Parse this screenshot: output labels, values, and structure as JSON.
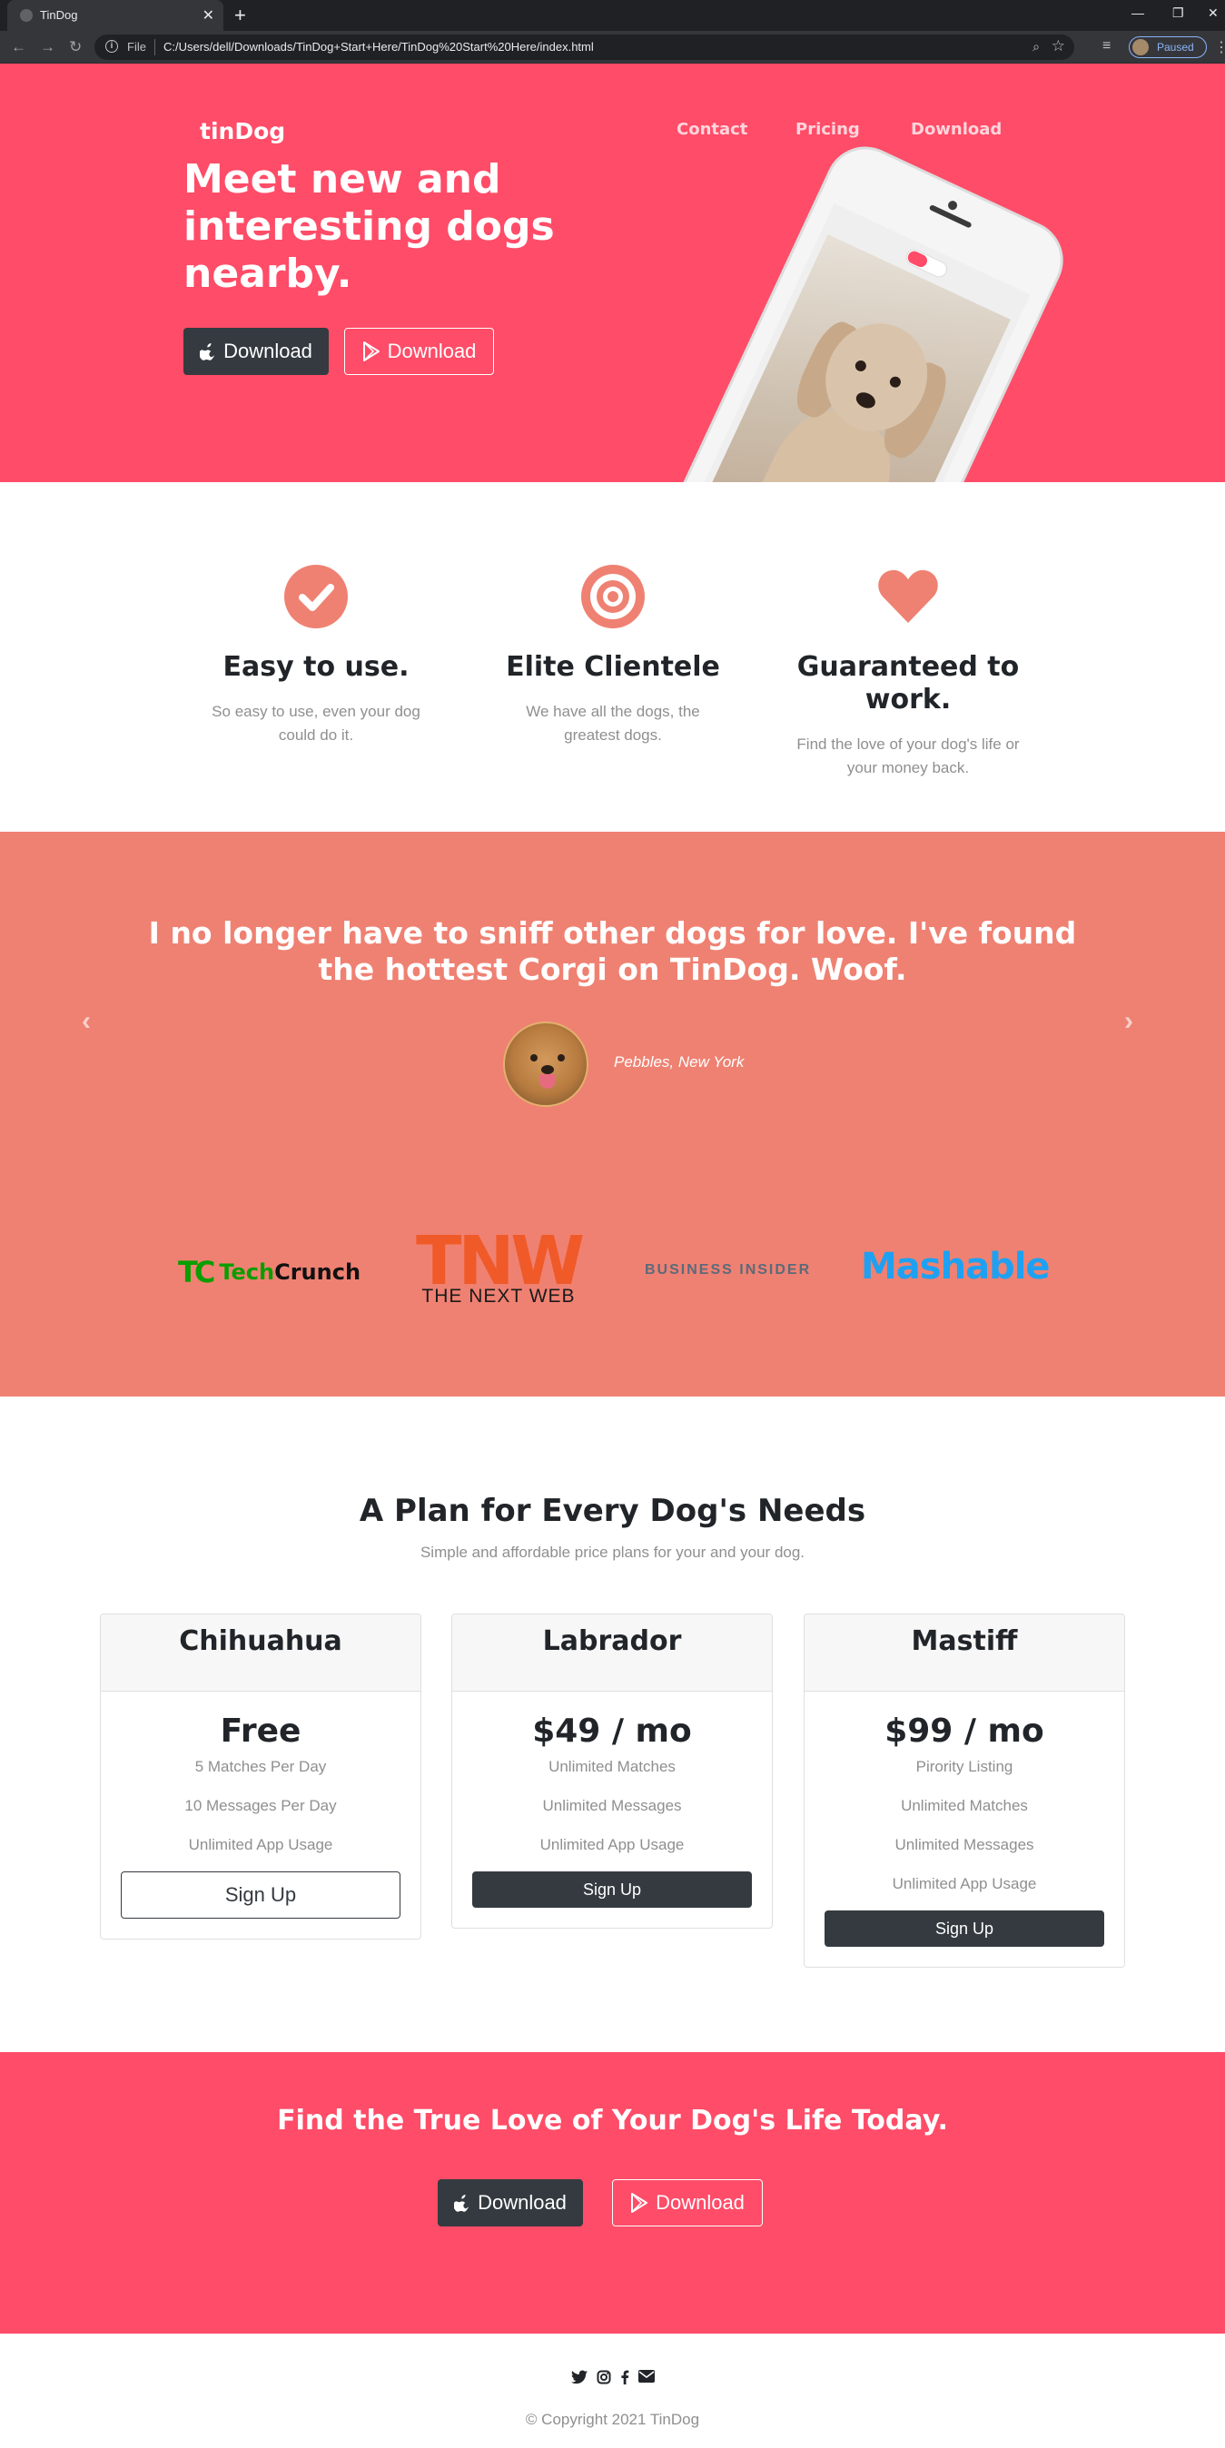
{
  "browser": {
    "tab_title": "TinDog",
    "address_scheme": "File",
    "url": "C:/Users/dell/Downloads/TinDog+Start+Here/TinDog%20Start%20Here/index.html",
    "profile_status": "Paused"
  },
  "hero": {
    "brand": "tinDog",
    "nav": [
      "Contact",
      "Pricing",
      "Download"
    ],
    "title": "Meet new and interesting dogs nearby.",
    "buttons": [
      {
        "label": "Download",
        "style": "dark",
        "icon": "apple-icon"
      },
      {
        "label": "Download",
        "style": "outline-light",
        "icon": "google-play-icon"
      }
    ]
  },
  "features": [
    {
      "icon": "check-circle-icon",
      "title": "Easy to use.",
      "text": "So easy to use, even your dog could do it."
    },
    {
      "icon": "bullseye-icon",
      "title": "Elite Clientele",
      "text": "We have all the dogs, the greatest dogs."
    },
    {
      "icon": "heart-icon",
      "title": "Guaranteed to work.",
      "text": "Find the love of your dog's life or your money back."
    }
  ],
  "testimonial": {
    "quote": "I no longer have to sniff other dogs for love. I've found the hottest Corgi on TinDog. Woof.",
    "name": "Pebbles, New York"
  },
  "press": {
    "techcrunch_mark": "TC",
    "techcrunch_word_a": "Tech",
    "techcrunch_word_b": "Crunch",
    "tnw_mark": "TNW",
    "tnw_sub": "THE NEXT WEB",
    "business_insider": "BUSINESS INSIDER",
    "mashable": "Mashable"
  },
  "pricing": {
    "title": "A Plan for Every Dog's Needs",
    "subtitle": "Simple and affordable price plans for your and your dog.",
    "plans": [
      {
        "name": "Chihuahua",
        "price": "Free",
        "features": [
          "5 Matches Per Day",
          "10 Messages Per Day",
          "Unlimited App Usage"
        ],
        "button": "Sign Up"
      },
      {
        "name": "Labrador",
        "price": "$49 / mo",
        "features": [
          "Unlimited Matches",
          "Unlimited Messages",
          "Unlimited App Usage"
        ],
        "button": "Sign Up"
      },
      {
        "name": "Mastiff",
        "price": "$99 / mo",
        "features": [
          "Pirority Listing",
          "Unlimited Matches",
          "Unlimited Messages",
          "Unlimited App Usage"
        ],
        "button": "Sign Up"
      }
    ]
  },
  "cta": {
    "title": "Find the True Love of Your Dog's Life Today.",
    "buttons": [
      {
        "label": "Download",
        "style": "dark",
        "icon": "apple-icon"
      },
      {
        "label": "Download",
        "style": "outline-light",
        "icon": "google-play-icon"
      }
    ]
  },
  "footer": {
    "icons": [
      "twitter-icon",
      "instagram-icon",
      "facebook-icon",
      "envelope-icon"
    ],
    "copyright": "© Copyright 2021 TinDog"
  },
  "colors": {
    "hero_bg": "#ff4c68",
    "testimonial_bg": "#ef8172",
    "icon_accent": "#ef8172",
    "dark_button": "#343a40"
  }
}
